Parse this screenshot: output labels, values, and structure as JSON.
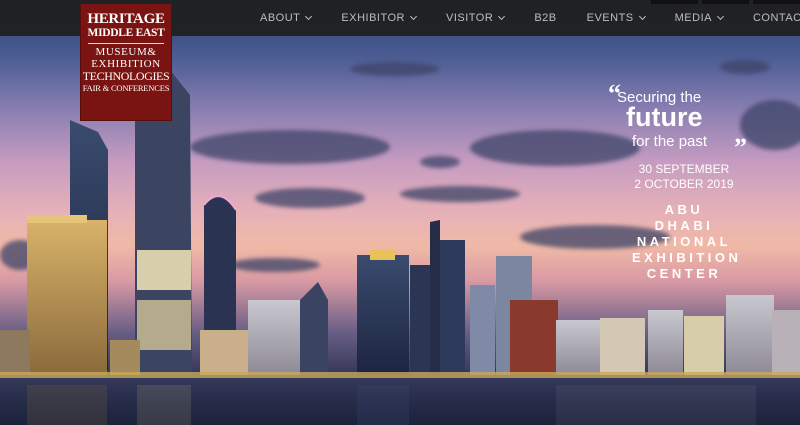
{
  "logo": {
    "line1": "HERITAGE",
    "line2": "MIDDLE EAST",
    "line3": "MUSEUM&",
    "line4": "EXHIBITION",
    "line5": "TECHNOLOGIES",
    "line6": "FAIR & CONFERENCES",
    "brand_color": "#7a1412"
  },
  "nav": {
    "items": [
      {
        "label": "ABOUT",
        "dropdown": true
      },
      {
        "label": "EXHIBITOR",
        "dropdown": true
      },
      {
        "label": "VISITOR",
        "dropdown": true
      },
      {
        "label": "B2B",
        "dropdown": false
      },
      {
        "label": "EVENTS",
        "dropdown": true
      },
      {
        "label": "MEDIA",
        "dropdown": true
      },
      {
        "label": "CONTACT",
        "dropdown": false
      }
    ]
  },
  "hero": {
    "quote_open": "“",
    "quote_close": "”",
    "tagline_1": "Securing the",
    "tagline_2": "future",
    "tagline_3": "for the past",
    "date_start": "30 SEPTEMBER",
    "date_end": "2 OCTOBER 2019",
    "venue_1": "ABU DHABI",
    "venue_2": "NATIONAL",
    "venue_3": "EXHIBITION",
    "venue_4": "CENTER"
  }
}
